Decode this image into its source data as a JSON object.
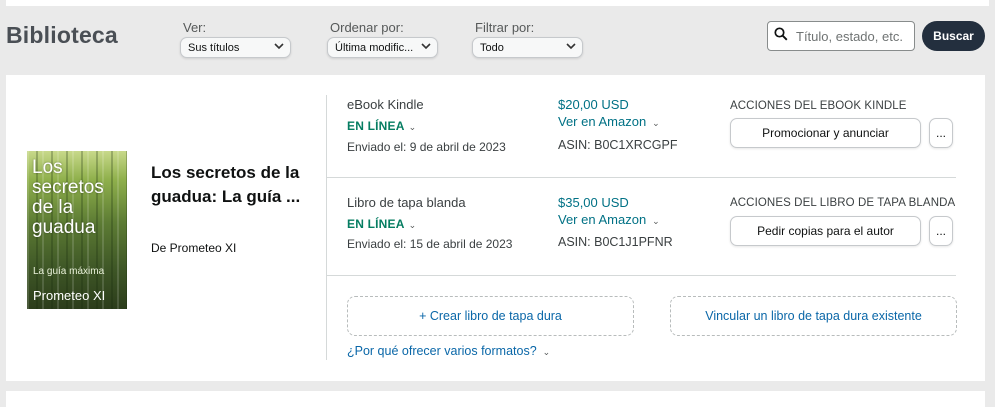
{
  "header": {
    "title": "Biblioteca",
    "filters": {
      "view": {
        "label": "Ver:",
        "value": "Sus títulos"
      },
      "sort": {
        "label": "Ordenar por:",
        "value": "Última modific..."
      },
      "filter": {
        "label": "Filtrar por:",
        "value": "Todo"
      }
    },
    "search": {
      "placeholder": "Título, estado, etc.",
      "button_label": "Buscar"
    }
  },
  "book": {
    "cover": {
      "title": "Los secretos de la guadua",
      "subtitle": "La guía máxima",
      "author": "Prometeo XI"
    },
    "title": "Los secretos de la guadua: La guía ...",
    "author_line": "De Prometeo XI",
    "formats": [
      {
        "format": "eBook Kindle",
        "status": "EN LÍNEA",
        "sent": "Enviado el: 9 de abril de 2023",
        "price": "$20,00 USD",
        "view_link": "Ver en Amazon",
        "asin": "ASIN: B0C1XRCGPF",
        "actions_header": "ACCIONES DEL EBOOK KINDLE",
        "action_button": "Promocionar y anunciar",
        "more_label": "..."
      },
      {
        "format": "Libro de tapa blanda",
        "status": "EN LÍNEA",
        "sent": "Enviado el: 15 de abril de 2023",
        "price": "$35,00 USD",
        "view_link": "Ver en Amazon",
        "asin": "ASIN: B0C1J1PFNR",
        "actions_header": "ACCIONES DEL LIBRO DE TAPA BLANDA",
        "action_button": "Pedir copias para el autor",
        "more_label": "..."
      }
    ],
    "create_hardcover": "+ Crear libro de tapa dura",
    "link_hardcover": "Vincular un libro de tapa dura existente",
    "why_formats": "¿Por qué ofrecer varios formatos?"
  },
  "colors": {
    "status_green": "#067d62",
    "link_teal": "#007185",
    "link_blue": "#0a67a8",
    "button_dark": "#232f3e"
  },
  "icons": {
    "search": "magnifier-icon",
    "dropdown": "chevron-down-icon"
  }
}
